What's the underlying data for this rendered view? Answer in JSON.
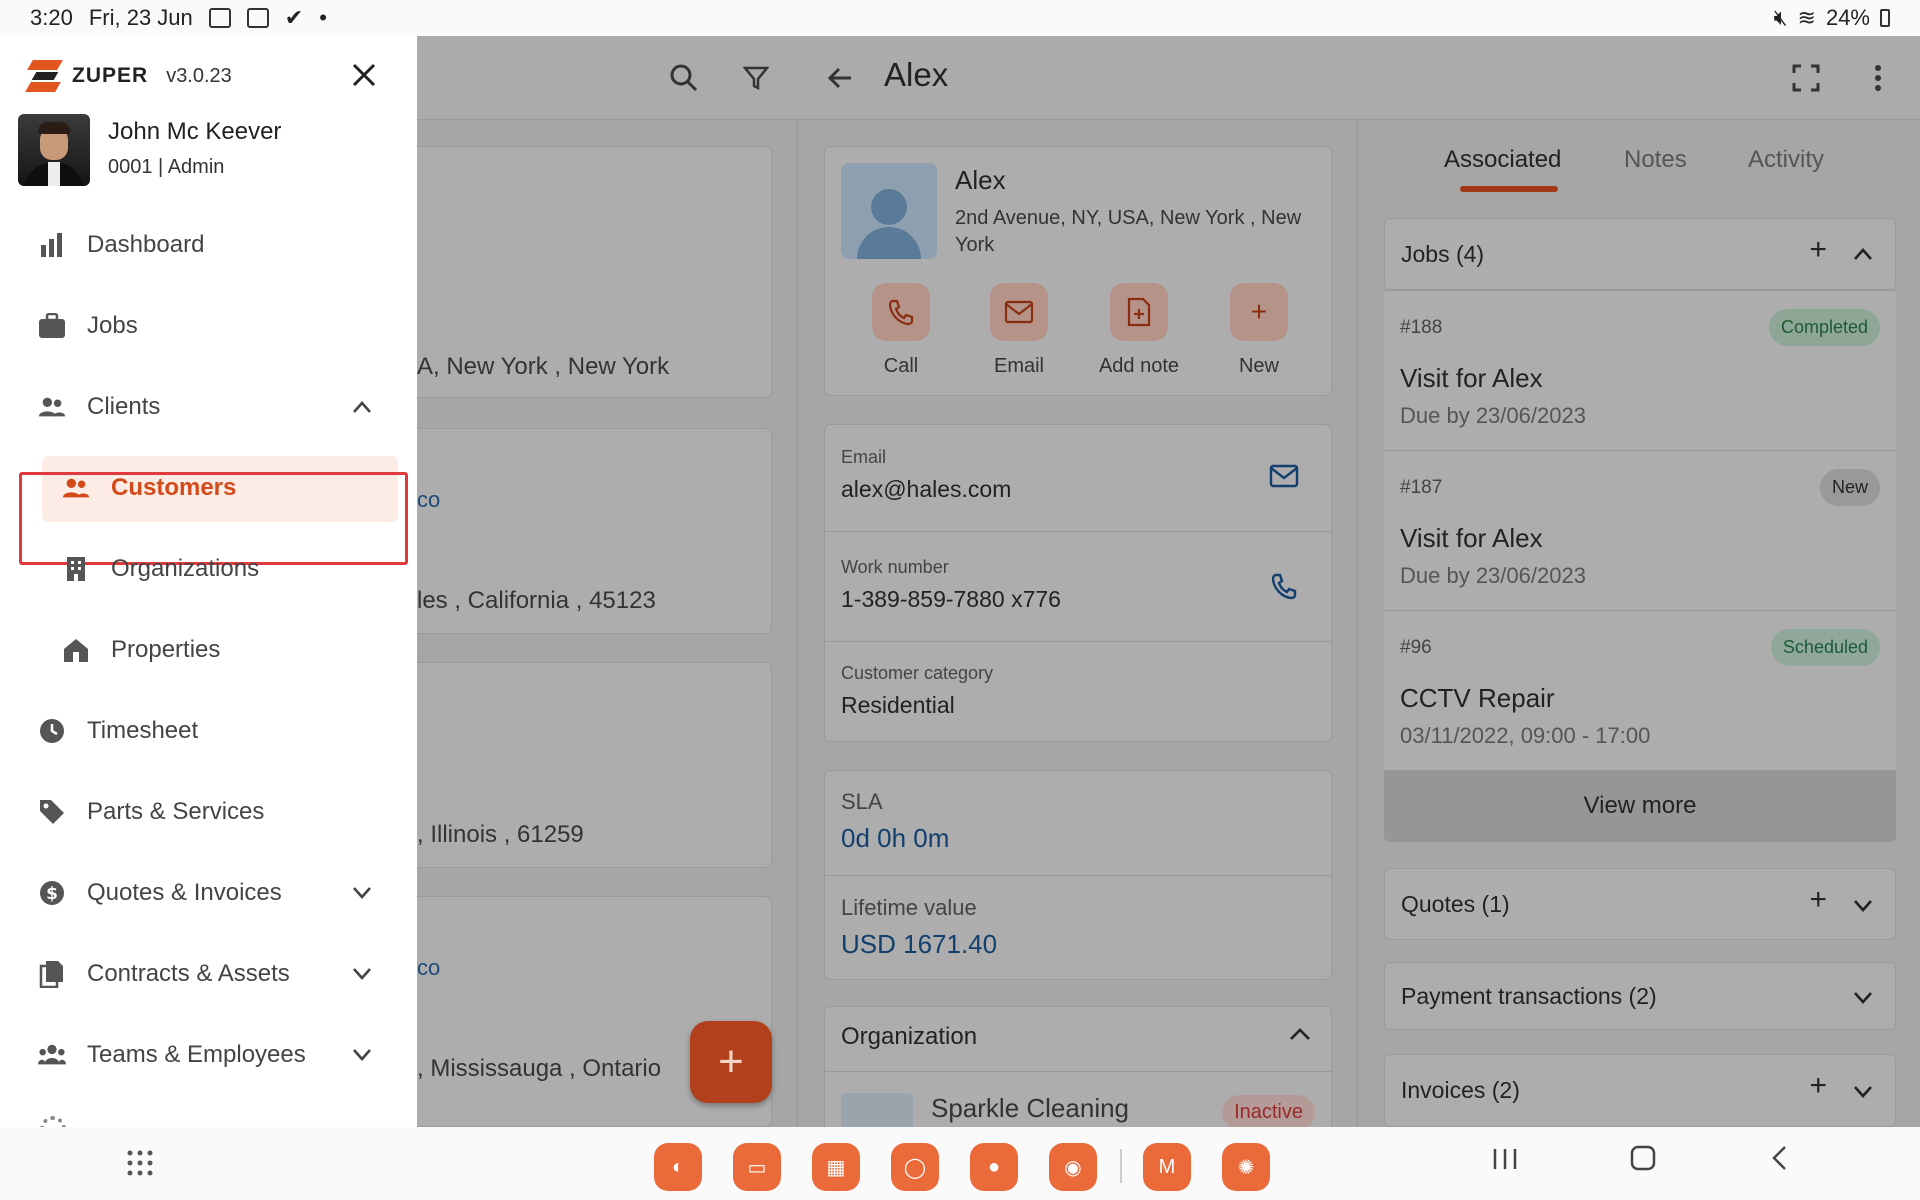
{
  "status_bar": {
    "time": "3:20",
    "date": "Fri, 23 Jun",
    "battery": "24%",
    "icons": [
      "image-icon",
      "calendar-icon",
      "check-icon",
      "dot-icon",
      "mute-icon",
      "wifi-icon",
      "battery-icon"
    ]
  },
  "drawer": {
    "brand": "ZUPER",
    "version": "v3.0.23",
    "user": {
      "name": "John Mc Keever",
      "role": "0001 | Admin"
    },
    "nav": {
      "dashboard": "Dashboard",
      "jobs": "Jobs",
      "clients": "Clients",
      "customers": "Customers",
      "organizations": "Organizations",
      "properties": "Properties",
      "timesheet": "Timesheet",
      "parts_services": "Parts & Services",
      "quotes_invoices": "Quotes & Invoices",
      "contracts_assets": "Contracts & Assets",
      "teams_employees": "Teams & Employees"
    }
  },
  "list": {
    "addresses": [
      "A, New York , New York",
      "les , California , 45123",
      ", Illinois , 61259",
      ", Mississauga , Ontario"
    ],
    "links": [
      "co",
      "co"
    ],
    "fab": "+"
  },
  "detail": {
    "title": "Alex",
    "customer": {
      "name": "Alex",
      "address": "2nd Avenue, NY, USA, New York , New York"
    },
    "actions": {
      "call": "Call",
      "email": "Email",
      "add_note": "Add note",
      "new": "New"
    },
    "fields": {
      "email_label": "Email",
      "email_value": "alex@hales.com",
      "work_label": "Work number",
      "work_value": "1-389-859-7880 x776",
      "category_label": "Customer category",
      "category_value": "Residential",
      "sla_label": "SLA",
      "sla_value": "0d 0h 0m",
      "lifetime_label": "Lifetime value",
      "lifetime_value": "USD 1671.40"
    },
    "organization": {
      "title": "Organization",
      "name": "Sparkle Cleaning",
      "status": "Inactive"
    }
  },
  "associated": {
    "tabs": {
      "associated": "Associated",
      "notes": "Notes",
      "activity": "Activity"
    },
    "jobs_header": "Jobs (4)",
    "jobs": [
      {
        "number": "#188",
        "title": "Visit for Alex",
        "due": "Due by 23/06/2023",
        "status": "Completed"
      },
      {
        "number": "#187",
        "title": "Visit for Alex",
        "due": "Due by 23/06/2023",
        "status": "New"
      },
      {
        "number": "#96",
        "title": "CCTV Repair",
        "due": "03/11/2022, 09:00 - 17:00",
        "status": "Scheduled"
      }
    ],
    "view_more": "View more",
    "quotes_header": "Quotes (1)",
    "payments_header": "Payment transactions (2)",
    "invoices_header": "Invoices (2)"
  },
  "colors": {
    "accent": "#d44a1b",
    "highlight_border": "#e0393e",
    "completed": "#1d5a33",
    "link": "#123f6e"
  }
}
